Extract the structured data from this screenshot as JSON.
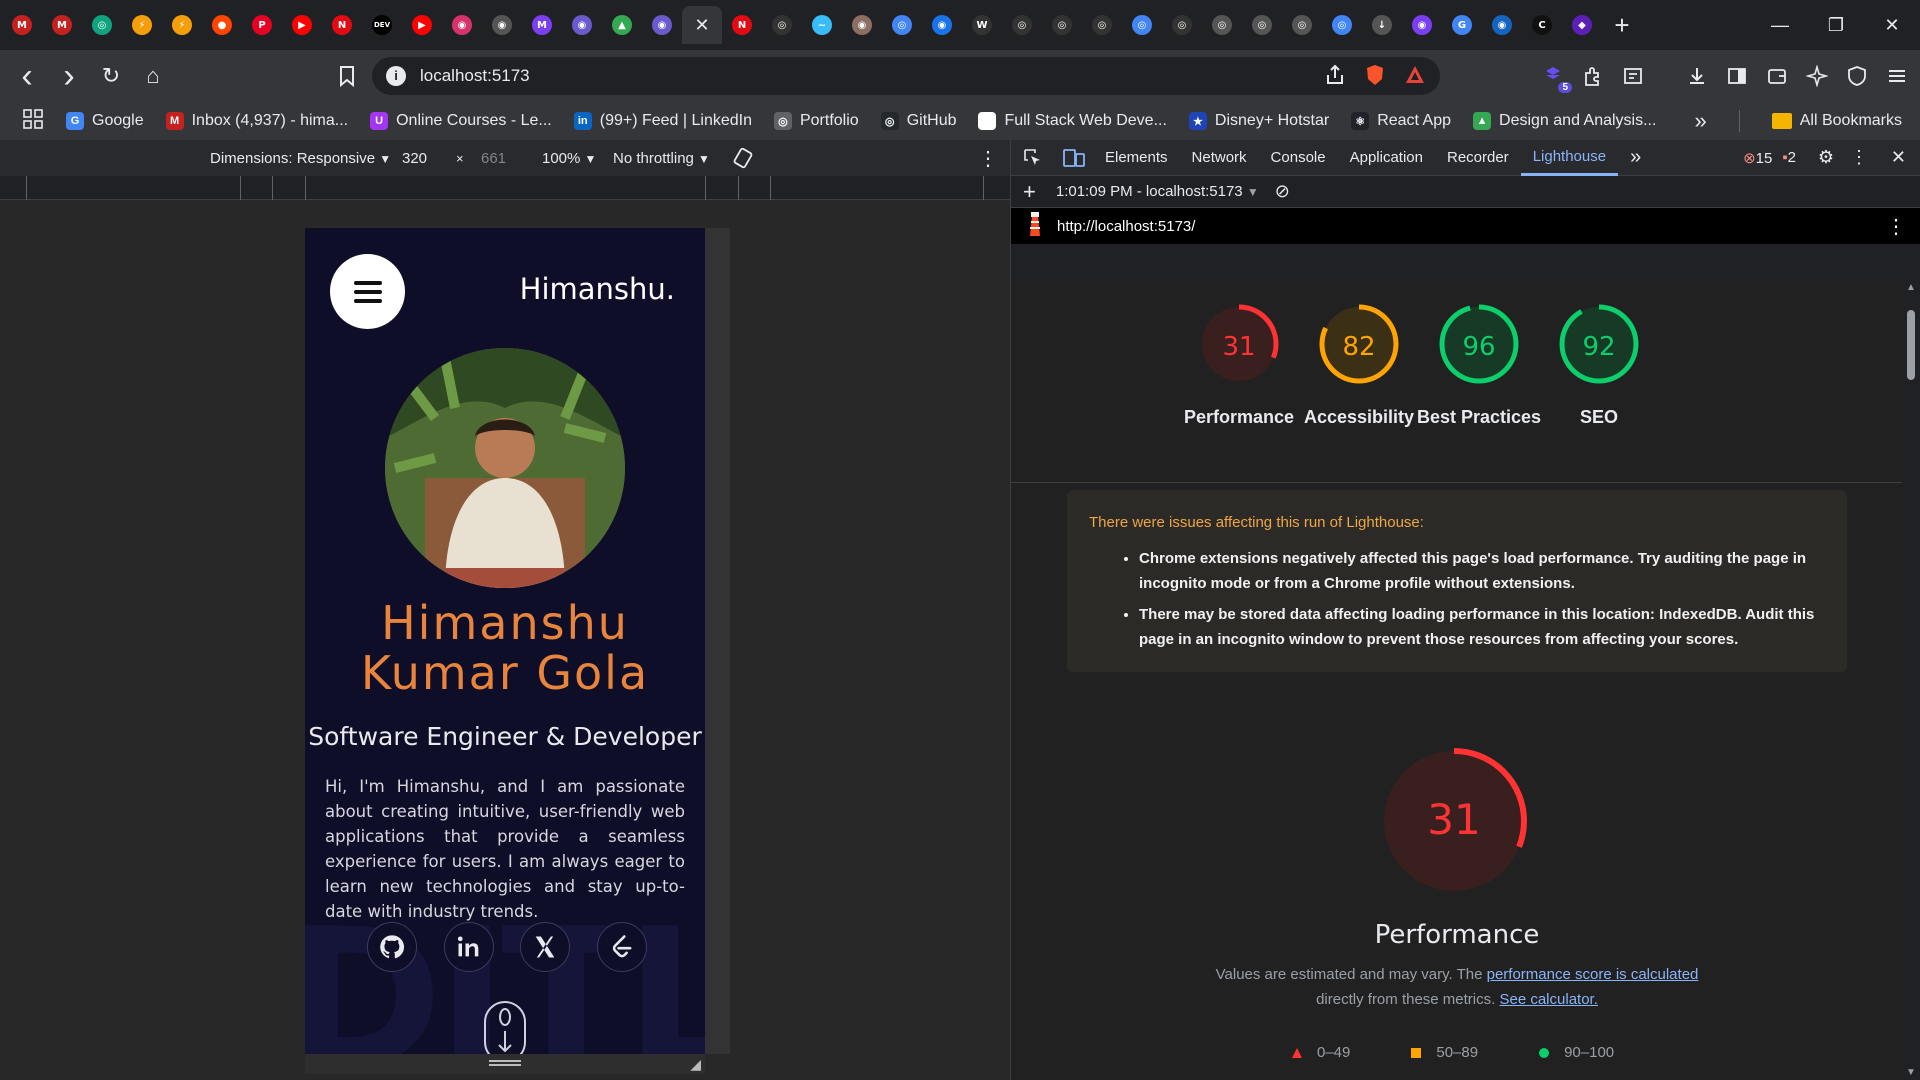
{
  "tabs": {
    "favicons": [
      {
        "glyph": "M",
        "color": "#c5221f"
      },
      {
        "glyph": "M",
        "color": "#c5221f"
      },
      {
        "glyph": "◎",
        "color": "#10a37f"
      },
      {
        "glyph": "⚡",
        "color": "#f59e0b"
      },
      {
        "glyph": "⚡",
        "color": "#f59e0b"
      },
      {
        "glyph": "●",
        "color": "#ff4500"
      },
      {
        "glyph": "P",
        "color": "#e60023"
      },
      {
        "glyph": "▶",
        "color": "#ff0000"
      },
      {
        "glyph": "N",
        "color": "#e50914"
      },
      {
        "glyph": "DEV",
        "color": "#000000"
      },
      {
        "glyph": "▶",
        "color": "#ff0000"
      },
      {
        "glyph": "◉",
        "color": "#d6336c"
      },
      {
        "glyph": "◉",
        "color": "#555555"
      },
      {
        "glyph": "M",
        "color": "#7b3ff2"
      },
      {
        "glyph": "◉",
        "color": "#6a5acd"
      },
      {
        "glyph": "▲",
        "color": "#34a853"
      },
      {
        "glyph": "◉",
        "color": "#6a5acd"
      },
      {
        "glyph": "●",
        "color": "#ff4500"
      },
      {
        "glyph": "N",
        "color": "#e50914"
      },
      {
        "glyph": "◎",
        "color": "#333333"
      },
      {
        "glyph": "~",
        "color": "#38bdf8"
      },
      {
        "glyph": "◉",
        "color": "#8d6e63"
      },
      {
        "glyph": "◎",
        "color": "#4285f4"
      },
      {
        "glyph": "◉",
        "color": "#1a73e8"
      },
      {
        "glyph": "W",
        "color": "#333333"
      },
      {
        "glyph": "◎",
        "color": "#333333"
      },
      {
        "glyph": "◎",
        "color": "#333333"
      },
      {
        "glyph": "◎",
        "color": "#333333"
      },
      {
        "glyph": "◎",
        "color": "#4285f4"
      },
      {
        "glyph": "◎",
        "color": "#333333"
      },
      {
        "glyph": "◎",
        "color": "#555555"
      },
      {
        "glyph": "◎",
        "color": "#555555"
      },
      {
        "glyph": "◎",
        "color": "#555555"
      },
      {
        "glyph": "◎",
        "color": "#4285f4"
      },
      {
        "glyph": "↓",
        "color": "#555555"
      },
      {
        "glyph": "◉",
        "color": "#7b3ff2"
      },
      {
        "glyph": "G",
        "color": "#4285f4"
      },
      {
        "glyph": "◉",
        "color": "#1565c0"
      },
      {
        "glyph": "C",
        "color": "#111111"
      },
      {
        "glyph": "◆",
        "color": "#5b21b6"
      }
    ],
    "active_index": 17,
    "active_close": "✕",
    "new_tab": "+"
  },
  "window_controls": {
    "minimize": "—",
    "maximize": "❐",
    "close": "✕"
  },
  "toolbar": {
    "back": "‹",
    "forward": "›",
    "reload": "↻",
    "home": "⌂",
    "bookmark": "☐",
    "url": "localhost:5173",
    "info": "i",
    "extension_badge": "5"
  },
  "bookmarks": {
    "items": [
      {
        "label": "Google",
        "icon": "G",
        "color": "#4285f4"
      },
      {
        "label": "Inbox (4,937) - hima...",
        "icon": "M",
        "color": "#c5221f"
      },
      {
        "label": "Online Courses - Le...",
        "icon": "U",
        "color": "#a435f0"
      },
      {
        "label": "(99+) Feed | LinkedIn",
        "icon": "in",
        "color": "#0a66c2"
      },
      {
        "label": "Portfolio",
        "icon": "◎",
        "color": "#5f6368"
      },
      {
        "label": "GitHub",
        "icon": "◎",
        "color": "#24292e"
      },
      {
        "label": "Full Stack Web Deve...",
        "icon": "",
        "color": "#ffffff"
      },
      {
        "label": "Disney+ Hotstar",
        "icon": "★",
        "color": "#1f44b5"
      },
      {
        "label": "React App",
        "icon": "⚛",
        "color": "#20232a"
      },
      {
        "label": "Design and Analysis...",
        "icon": "▲",
        "color": "#34a853"
      }
    ],
    "overflow": "»",
    "all_bookmarks": "All Bookmarks"
  },
  "device_toolbar": {
    "dimensions": "Dimensions: Responsive",
    "width": "320",
    "times": "×",
    "height": "661",
    "zoom": "100%",
    "throttling": "No throttling"
  },
  "page": {
    "brand": "Himanshu.",
    "name_line1": "Himanshu",
    "name_line2": "Kumar Gola",
    "role": "Software Engineer & Developer",
    "bio": "Hi, I'm Himanshu, and I am passionate about creating intuitive, user-friendly web applications that provide a seamless experience for users. I am always eager to learn new technologies and stay up-to-date with industry trends.",
    "bg_text": "DITLV",
    "socials": [
      "github-icon",
      "linkedin-icon",
      "x-icon",
      "leetcode-icon"
    ]
  },
  "devtools": {
    "tabs": [
      "Elements",
      "Network",
      "Console",
      "Application",
      "Recorder",
      "Lighthouse"
    ],
    "active_tab": "Lighthouse",
    "errors": "15",
    "issues": "2",
    "report_selector": "1:01:09 PM - localhost:5173",
    "report_url": "http://localhost:5173/"
  },
  "lighthouse": {
    "scores": [
      {
        "label": "Performance",
        "value": 31,
        "color": "#ff3333"
      },
      {
        "label": "Accessibility",
        "value": 82,
        "color": "#ffa400"
      },
      {
        "label": "Best Practices",
        "value": 96,
        "color": "#0cce6b"
      },
      {
        "label": "SEO",
        "value": 92,
        "color": "#0cce6b"
      }
    ],
    "warning_title": "There were issues affecting this run of Lighthouse:",
    "warnings": [
      "Chrome extensions negatively affected this page's load performance. Try auditing the page in incognito mode or from a Chrome profile without extensions.",
      "There may be stored data affecting loading performance in this location: IndexedDB. Audit this page in an incognito window to prevent those resources from affecting your scores."
    ],
    "perf_score": 31,
    "perf_title": "Performance",
    "perf_note_1": "Values are estimated and may vary. The",
    "perf_note_link1": "performance score is calculated",
    "perf_note_2": "directly from these metrics.",
    "perf_note_link2": "See calculator.",
    "legend": [
      {
        "range": "0–49",
        "shape": "triangle",
        "color": "#ff3333"
      },
      {
        "range": "50–89",
        "shape": "square",
        "color": "#ffa400"
      },
      {
        "range": "90–100",
        "shape": "circle",
        "color": "#0cce6b"
      }
    ]
  }
}
